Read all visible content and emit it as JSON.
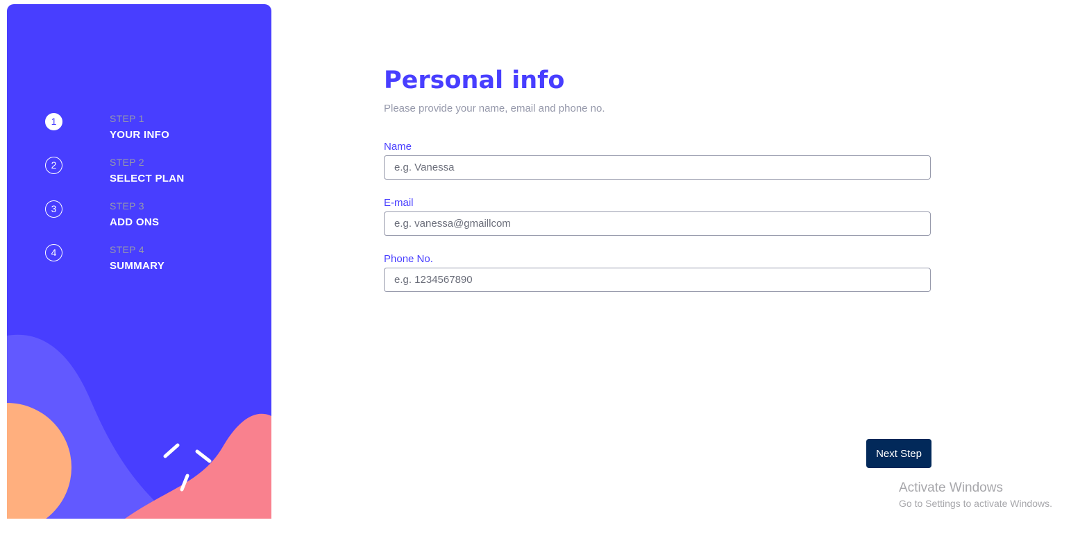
{
  "colors": {
    "sidebar_bg": "#483eff",
    "accent": "#483eff",
    "muted": "#9699ab",
    "button_bg": "#02295a",
    "blob_orange": "#ffaf7e",
    "blob_purple": "#6259ff",
    "blob_pink": "#f9818e"
  },
  "sidebar": {
    "steps": [
      {
        "number": "1",
        "small": "STEP 1",
        "big": "YOUR INFO",
        "active": true
      },
      {
        "number": "2",
        "small": "STEP 2",
        "big": "SELECT PLAN",
        "active": false
      },
      {
        "number": "3",
        "small": "STEP 3",
        "big": "ADD ONS",
        "active": false
      },
      {
        "number": "4",
        "small": "STEP 4",
        "big": "SUMMARY",
        "active": false
      }
    ]
  },
  "main": {
    "title": "Personal info",
    "subtitle": "Please provide your name, email and phone no.",
    "fields": [
      {
        "label": "Name",
        "placeholder": "e.g. Vanessa",
        "value": ""
      },
      {
        "label": "E-mail",
        "placeholder": "e.g. vanessa@gmaillcom",
        "value": ""
      },
      {
        "label": "Phone No.",
        "placeholder": "e.g. 1234567890",
        "value": ""
      }
    ],
    "next_button": "Next Step"
  },
  "watermark": {
    "title": "Activate Windows",
    "subtitle": "Go to Settings to activate Windows."
  }
}
